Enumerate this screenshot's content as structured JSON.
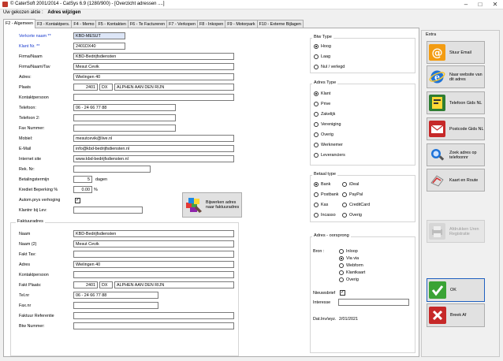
{
  "window": {
    "title": "© CaterSoft 2001/2014 - CatSys 6.9   (1280/900) - [Overzicht adressen ....]"
  },
  "breadcrumb": {
    "prefix": "Uw gekozen aktie :",
    "page": "Adres wijzigen"
  },
  "tabs": [
    {
      "label": "F2 - Algemeen",
      "active": true
    },
    {
      "label": "F3 - Kontaktpers."
    },
    {
      "label": "F4 - Memo"
    },
    {
      "label": "F5 - Kontakten"
    },
    {
      "label": "F6 - Te Factureren"
    },
    {
      "label": "F7 - Verkopen"
    },
    {
      "label": "F8 - Inkopen"
    },
    {
      "label": "F9 - Motorpark"
    },
    {
      "label": "F10 - Externe Bijlagen"
    }
  ],
  "form": {
    "verkorte_naam_label": "Verkorte naam **",
    "verkorte_naam": "KBD-MESUT",
    "klant_nr_label": "Klant Nr. **",
    "klant_nr": "2401DX40",
    "firma_naam_label": "Firma/Naam",
    "firma_naam": "KBD-Bedrijfsdiensten",
    "firma_naam_tav_label": "Firma/Naam/Tav",
    "firma_naam_tav": "Mesut Cevik",
    "adres_label": "Adres:",
    "adres": "Wielingen 40",
    "plaats_label": "Plaats",
    "postcode_num": "2401",
    "postcode_let": "DX",
    "plaats": "ALPHEN AAN DEN RIJN",
    "kontaktpersoon_label": "Kontaktpersoon",
    "kontaktpersoon": "",
    "telefoon_label": "Telefoon:",
    "telefoon": "06 - 24 66 77 88",
    "telefoon2_label": "Telefoon 2:",
    "telefoon2": "",
    "fax_label": "Fax Nummer:",
    "fax": "",
    "mobiel_label": "Mobiel:",
    "mobiel": "mesutcevik@live.nl",
    "email_label": "E-Mail",
    "email": "info@kbd-bedrijfsdiensten.nl",
    "internet_label": "Internet site",
    "internet": "www.kbd-bedrijfsdiensten.nl",
    "rek_nr_label": "Rek. Nr:",
    "rek_nr": "",
    "betalingstermijn_label": "Betalingstermijn",
    "betalingstermijn": "5",
    "betalingstermijn_unit": "dagen",
    "krediet_label": "Krediet Beperking %",
    "krediet": "0.00",
    "krediet_unit": "%",
    "autom_label": "Autom.prys verhoging",
    "autom_checked": true,
    "klantnr_lev_label": "Klantnr bij Lev:",
    "klantnr_lev": "",
    "bijwerken_label": "Bijwerken adres naar faktuuradres"
  },
  "faktuur": {
    "group_title": "Faktuuradres",
    "naam_label": "Naam",
    "naam": "KBD-Bedrijfsdiensten",
    "naam2_label": "Naam (2)",
    "naam2": "Mesut Cevik",
    "fakt_tav_label": "Fakt Tav:",
    "fakt_tav": "",
    "adres_label": "Adres",
    "adres": "Wielingen 40",
    "kontakt_label": "Kontaktpersoon",
    "kontakt": "",
    "plaats_label": "Fakt Plaats:",
    "postcode_num": "2401",
    "postcode_let": "DX",
    "plaats": "ALPHEN AAN DEN RIJN",
    "tel_label": "Tel.nr",
    "tel": "06 - 24 66 77 88",
    "fax_label": "Fax.nr",
    "fax": "",
    "referentie_label": "Faktuur Referentie",
    "referentie": "",
    "btw_label": "Btw Nummer:",
    "btw": ""
  },
  "btw_type": {
    "title": "Btw Type",
    "options": [
      "Hoog",
      "Laag",
      "Nul / verlegd"
    ],
    "selected": 0
  },
  "adres_type": {
    "title": "Adres Type",
    "options": [
      "Klant",
      "Prive",
      "Zakelijk",
      "Vereniging",
      "Overig",
      "Werknemer",
      "Leveranciers"
    ],
    "selected": 0
  },
  "betaal_type": {
    "title": "Betaal type",
    "left": [
      "Bank",
      "Postbank",
      "Kas",
      "Incasso"
    ],
    "right": [
      "iDeal",
      "PayPal",
      "CreditCard",
      "Overig"
    ],
    "selected": "Bank"
  },
  "herkomst": {
    "title": "Adres - oorsprong",
    "bron_label": "Bron :",
    "options": [
      "Inloop",
      "Via via",
      "Webform",
      "Klantkaart",
      "Overig"
    ],
    "selected": 1,
    "nieuwsbrief_label": "Nieuwsbrief",
    "nieuwsbrief_checked": true,
    "interesse_label": "Interesse",
    "interesse": "",
    "datum_label": "Dat.Inv/wyz.",
    "datum": "2/01/2021"
  },
  "extra": {
    "title": "Extra",
    "buttons": [
      {
        "label": "Stuur Email",
        "icon": "email-icon"
      },
      {
        "label": "Naar website van dit adres",
        "icon": "internet-explorer-icon"
      },
      {
        "label": "Telefoon Gids NL",
        "icon": "phonebook-icon"
      },
      {
        "label": "Postcode Gids NL",
        "icon": "postcode-icon"
      },
      {
        "label": "Zoek adres op telefoonnr",
        "icon": "phone-search-icon"
      },
      {
        "label": "Kaart en Route",
        "icon": "route-icon"
      }
    ],
    "disabled_button": "Afdrukken Uren Registratie",
    "ok_label": "OK",
    "cancel_label": "Breek Af"
  },
  "colors": {
    "accent_blue": "#1a3ccf",
    "highlight_field": "#dde6f7",
    "ok_green": "#3aa335",
    "cancel_red": "#c62828"
  }
}
